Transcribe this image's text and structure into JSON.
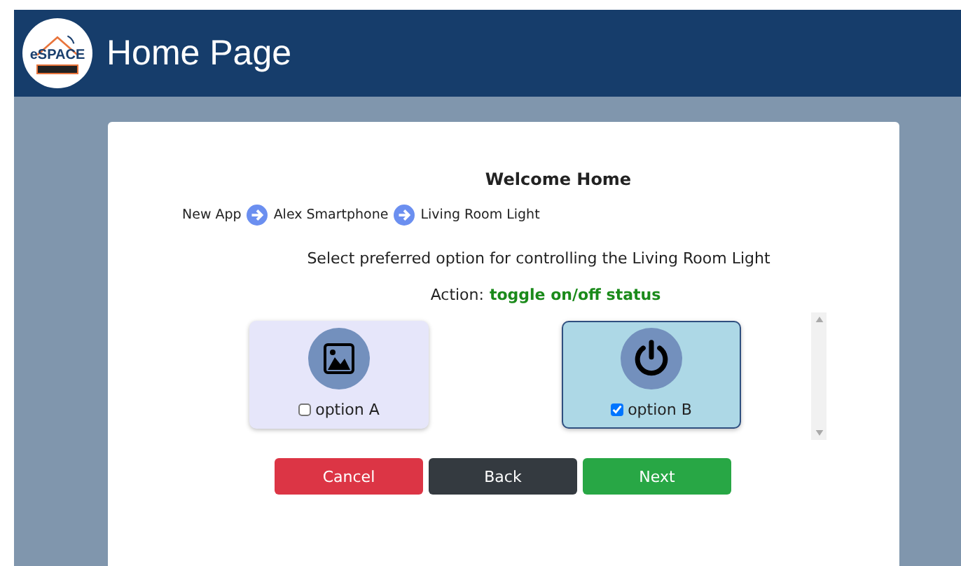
{
  "header": {
    "logo_text": "eSPACE",
    "title": "Home Page"
  },
  "card": {
    "heading": "Welcome Home",
    "breadcrumb": [
      "New App",
      "Alex Smartphone",
      "Living Room Light"
    ],
    "prompt": "Select preferred option for controlling the Living Room Light",
    "action_label": "Action:",
    "action_value": "toggle on/off status",
    "options": [
      {
        "kind": "image",
        "label": "option A",
        "selected": false
      },
      {
        "kind": "power",
        "label": "option B",
        "selected": true
      }
    ],
    "buttons": [
      {
        "kind": "cancel",
        "label": "Cancel"
      },
      {
        "kind": "back",
        "label": "Back"
      },
      {
        "kind": "next",
        "label": "Next"
      }
    ]
  }
}
